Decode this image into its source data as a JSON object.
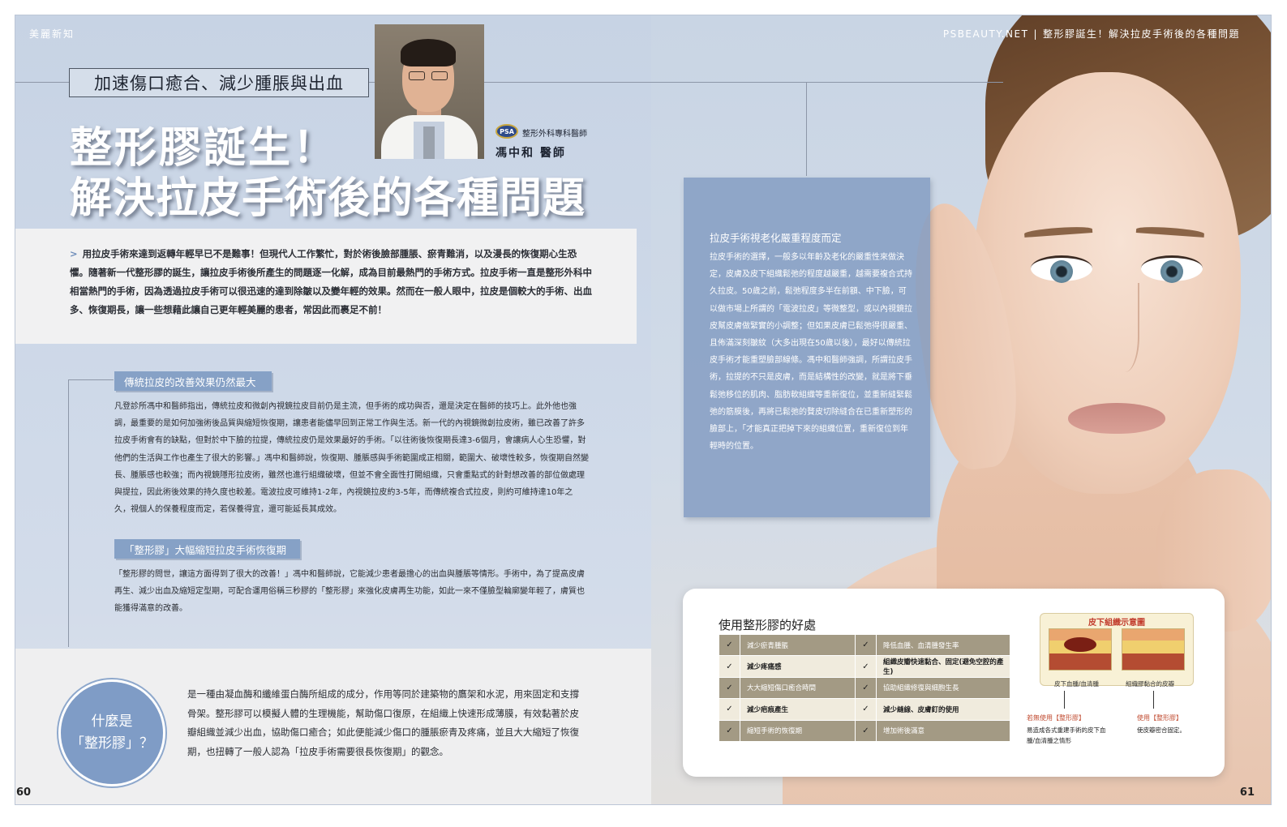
{
  "header": {
    "section": "美麗新知",
    "site": "PSBEAUTY.NET",
    "separator": "|",
    "article_title": "整形膠誕生！解決拉皮手術後的各種問題"
  },
  "subtitle": "加速傷口癒合、減少腫脹與出血",
  "title": {
    "line1": "整形膠誕生！",
    "line2": "解決拉皮手術後的各種問題"
  },
  "doctor": {
    "badge": "PSA",
    "title": "整形外科專科醫師",
    "name": "馮中和 醫師"
  },
  "intro": {
    "arrow": ">",
    "text": "用拉皮手術來達到返轉年輕早已不是難事！但現代人工作繁忙，對於術後臉部腫脹、瘀青難消，以及漫長的恢復期心生恐懼。隨著新一代整形膠的誕生，讓拉皮手術後所產生的問題逐一化解，成為目前最熱門的手術方式。拉皮手術一直是整形外科中相當熱門的手術，因為透過拉皮手術可以很迅速的達到除皺以及變年輕的效果。然而在一般人眼中，拉皮是個較大的手術、出血多、恢復期長，讓一些想藉此讓自己更年輕美麗的患者，常因此而裹足不前！"
  },
  "section1": {
    "heading": "傳統拉皮的改善效果仍然最大",
    "text": "凡登診所馮中和醫師指出，傳統拉皮和微創內視鏡拉皮目前仍是主流，但手術的成功與否，還是決定在醫師的技巧上。此外他也強調，最重要的是如何加強術後品質與縮短恢復期，讓患者能儘早回到正常工作與生活。新一代的內視鏡微創拉皮術，雖已改善了許多拉皮手術會有的缺點，但對於中下臉的拉提，傳統拉皮仍是效果最好的手術。「以往術後恢復期長達3-6個月，會讓病人心生恐懼，對他們的生活與工作也產生了很大的影響。」馮中和醫師說，恢復期、腫脹感與手術範圍成正相關，範圍大、破壞性較多，恢復期自然變長、腫脹感也較強；而內視鏡隱形拉皮術，雖然也進行組織破壞，但並不會全面性打開組織，只會重點式的針對想改善的部位做處理與提拉，因此術後效果的持久度也較差。電波拉皮可維持1-2年，內視鏡拉皮約3-5年，而傳統複合式拉皮，則約可維持達10年之久，視個人的保養程度而定，若保養得宜，還可能延長其成效。"
  },
  "section2": {
    "heading": "「整形膠」大幅縮短拉皮手術恢復期",
    "text": "「整形膠的問世，讓這方面得到了很大的改善！」馮中和醫師說，它能減少患者最擔心的出血與腫脹等情形。手術中，為了提高皮膚再生、減少出血及縮短定型期，可配合運用俗稱三秒膠的「整形膠」來強化皮膚再生功能，如此一來不僅臉型輪廓變年輕了，膚質也能獲得滿意的改善。"
  },
  "whatis": {
    "circle_line1": "什麼是",
    "circle_line2": "「整形膠」？",
    "text": "是一種由凝血酶和纖維蛋白酶所組成的成分，作用等同於建築物的鷹架和水泥，用來固定和支撐骨架。整形膠可以模擬人體的生理機能，幫助傷口復原，在組織上快速形成薄膜，有效黏著於皮瓣組織並減少出血，協助傷口癒合；如此便能減少傷口的腫脹瘀青及疼痛，並且大大縮短了恢復期，也扭轉了一般人認為「拉皮手術需要很長恢復期」的觀念。"
  },
  "infobox": {
    "title": "拉皮手術視老化嚴重程度而定",
    "text": "拉皮手術的選擇，一般多以年齡及老化的嚴重性來做決定，皮膚及皮下組織鬆弛的程度越嚴重，越需要複合式持久拉皮。50歲之前，鬆弛程度多半在前額、中下臉，可以做市場上所謂的「電波拉皮」等微整型，或以內視鏡拉皮幫皮膚做緊實的小調整；但如果皮膚已鬆弛得很嚴重、且佈滿深刻皺紋（大多出現在50歲以後），最好以傳統拉皮手術才能重塑臉部線條。馮中和醫師強調，所謂拉皮手術，拉提的不只是皮膚，而是結構性的改變，就是將下垂鬆弛移位的肌肉、脂肪軟組織等重新復位，並重新縫緊鬆弛的筋膜後，再將已鬆弛的贅皮切除縫合在已重新塑形的臉部上，「才能真正把掉下來的組織位置，重新復位到年輕時的位置。"
  },
  "benefits": {
    "title": "使用整形膠的好處",
    "check": "✓",
    "rows": [
      {
        "a": "減少瘀青腫脹",
        "b": "降低血腫、血清腫發生率"
      },
      {
        "a": "減少疼痛感",
        "b": "組織皮瓣快速黏合、固定(避免空腔的產生)"
      },
      {
        "a": "大大縮短傷口癒合時間",
        "b": "協助組織修復與細胞生長"
      },
      {
        "a": "減少疤痕產生",
        "b": "減少縫線、皮膚釘的使用"
      },
      {
        "a": "縮短手術的恢復期",
        "b": "增加術後滿意"
      }
    ]
  },
  "diagram": {
    "title": "皮下組織示意圖",
    "cap_left": "皮下血腫/血清腫",
    "cap_right": "組織膠黏合的皮瓣",
    "note_left_title": "若無使用【整形膠】",
    "note_left_text": "易造成各式重建手術的皮下血腫/血清腫之情形",
    "note_right_title": "使用【整形膠】",
    "note_right_text": "使皮瓣密合固定。"
  },
  "pages": {
    "left": "60",
    "right": "61"
  }
}
